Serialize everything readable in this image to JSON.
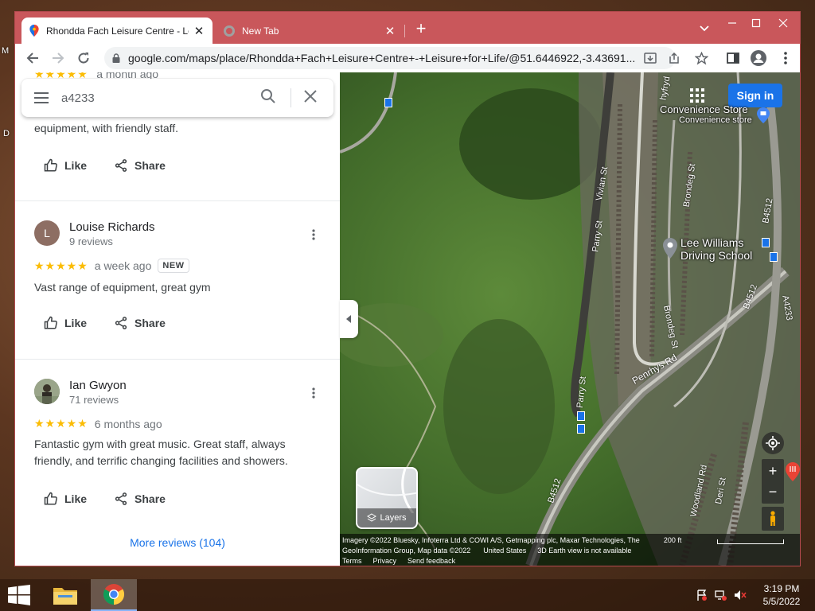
{
  "desktop": {
    "label_m": "M",
    "label_d": "D"
  },
  "browser": {
    "tabs": [
      {
        "title": "Rhondda Fach Leisure Centre - Le",
        "active": true,
        "icon": "maps-pin-icon"
      },
      {
        "title": "New Tab",
        "active": false,
        "icon": "chrome-icon"
      }
    ],
    "url": "google.com/maps/place/Rhondda+Fach+Leisure+Centre+-+Leisure+for+Life/@51.6446922,-3.43691..."
  },
  "search": {
    "value": "a4233"
  },
  "reviews": {
    "fragment": {
      "time": "a month ago",
      "text": "equipment, with friendly staff."
    },
    "items": [
      {
        "name": "Louise Richards",
        "initial": "L",
        "count": "9 reviews",
        "stars": "★★★★★",
        "time": "a week ago",
        "badge": "NEW",
        "text": "Vast range of equipment, great gym"
      },
      {
        "name": "Ian Gwyon",
        "initial": "",
        "count": "71 reviews",
        "stars": "★★★★★",
        "time": "6 months ago",
        "badge": "",
        "text": "Fantastic gym with great music. Great staff, always friendly, and terrific changing facilities and showers."
      }
    ],
    "like_label": "Like",
    "share_label": "Share",
    "more": "More reviews (104)"
  },
  "map": {
    "sign_in": "Sign in",
    "places": {
      "convenience_name": "Convenience Store",
      "convenience_sub": "Convenience store",
      "driving_school_1": "Lee Williams",
      "driving_school_2": "Driving School"
    },
    "roads": {
      "vivian": "Vivian St",
      "parry_top": "Parry St",
      "parry_bottom": "Parry St",
      "brondeg_top": "Brondeg St",
      "brondeg_mid": "Brondeg St",
      "penrhys": "Penrhys Rd",
      "b4512_a": "B4512",
      "b4512_b": "B4512",
      "b4512_c": "B4512",
      "a4233": "A4233",
      "woodland": "Woodland Rd",
      "deri": "Deri St",
      "hyfryd": "hyfryd"
    },
    "layers_label": "Layers",
    "attribution_1": "Imagery ©2022 Bluesky, Infoterra Ltd & COWI A/S, Getmapping plc, Maxar Technologies, The",
    "attribution_2": "GeoInformation Group, Map data ©2022",
    "region": "United States",
    "earth_note": "3D Earth view is not available",
    "terms": "Terms",
    "privacy": "Privacy",
    "feedback": "Send feedback",
    "scale": "200 ft"
  },
  "taskbar": {
    "time": "3:19 PM",
    "date": "5/5/2022"
  },
  "colors": {
    "accent": "#1a73e8",
    "star": "#fbbc04",
    "frame": "#c9575b"
  }
}
